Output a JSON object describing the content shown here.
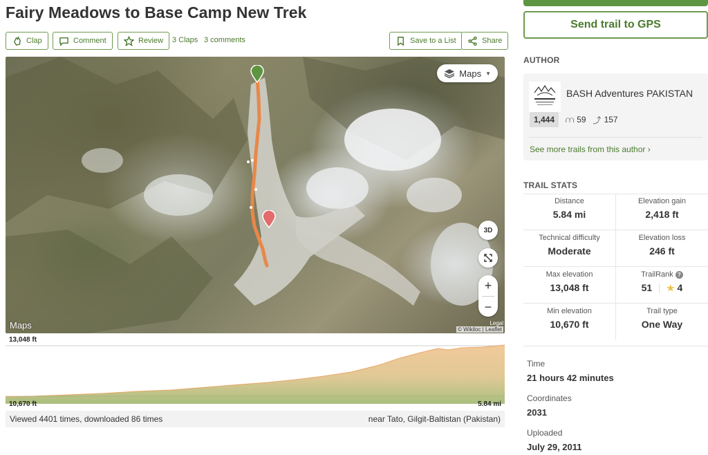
{
  "trail": {
    "title": "Fairy Meadows to Base Camp New Trek"
  },
  "actions": {
    "clap": "Clap",
    "comment": "Comment",
    "review": "Review",
    "claps_count": "3 Claps",
    "comments_count": "3 comments",
    "save_list": "Save to a List",
    "share": "Share"
  },
  "map": {
    "layer_label": "Maps",
    "btn_3d": "3D",
    "zoom_in": "+",
    "zoom_out": "−",
    "apple_maps": "Maps",
    "legal": "Legal",
    "attribution": "© Wikiloc | Leaflet"
  },
  "elevation": {
    "max_label": "13,048 ft",
    "min_label": "10,670 ft",
    "distance_label": "5.84 mi"
  },
  "footer": {
    "views": "Viewed 4401 times, downloaded 86 times",
    "location": "near Tato, Gilgit-Baltistan (Pakistan)"
  },
  "sidebar": {
    "gps_button": "Send trail to GPS",
    "author_heading": "AUTHOR",
    "author_name": "BASH Adventures PAKISTAN",
    "author_trails": "1,444",
    "author_followers": "59",
    "author_following": "157",
    "author_more": "See more trails from this author ›",
    "stats_heading": "TRAIL STATS"
  },
  "stats": {
    "distance": {
      "label": "Distance",
      "value": "5.84 mi"
    },
    "gain": {
      "label": "Elevation gain",
      "value": "2,418 ft"
    },
    "difficulty": {
      "label": "Technical difficulty",
      "value": "Moderate"
    },
    "loss": {
      "label": "Elevation loss",
      "value": "246 ft"
    },
    "max_elev": {
      "label": "Max elevation",
      "value": "13,048 ft"
    },
    "trailrank": {
      "label": "TrailRank",
      "value": "51",
      "stars": "4"
    },
    "min_elev": {
      "label": "Min elevation",
      "value": "10,670 ft"
    },
    "type": {
      "label": "Trail type",
      "value": "One Way"
    }
  },
  "extra": {
    "time": {
      "label": "Time",
      "value": "21 hours 42 minutes"
    },
    "coords": {
      "label": "Coordinates",
      "value": "2031"
    },
    "uploaded": {
      "label": "Uploaded",
      "value": "July 29, 2011"
    }
  },
  "colors": {
    "accent": "#4b7a2c",
    "route": "#e8884a",
    "profile_fill_top": "#f2c99a",
    "profile_fill_bottom": "#a9bf7e"
  }
}
